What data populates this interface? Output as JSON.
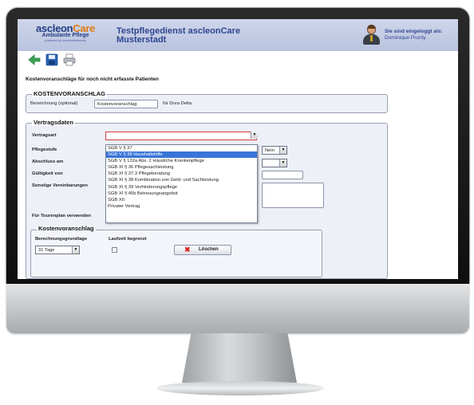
{
  "app": {
    "logo": {
      "brand_a": "ascleon",
      "brand_b": "Care",
      "subtitle": "Ambulante Pflege",
      "tagline": "powered by medicalnetworks"
    },
    "service_name": "Testpflegedienst ascleonCare",
    "service_city": "Musterstadt",
    "login": {
      "label": "Sie sind eingeloggt als:",
      "user": "Dominique Prunty"
    }
  },
  "toolbar": {
    "icons": [
      "back-arrow-icon",
      "save-disk-icon",
      "print-icon"
    ]
  },
  "page": {
    "title": "Kostenvoranschläge für noch nicht erfasste Patienten"
  },
  "kv_section": {
    "legend": "KOSTENVORANSCHLAG",
    "bezeichnung_label": "Bezeichnung (optional)",
    "bezeichnung_value": "Kostenvoranschlag",
    "patient_text": "für Dora Delta"
  },
  "vertrag": {
    "legend": "Vertragsdaten",
    "labels": {
      "vertragsart": "Vertragsart",
      "pflegestufe": "Pflegestufe",
      "abschluss": "Abschluss am",
      "gueltigkeit": "Gültigkeit von",
      "sonstige": "Sonstige Vereinbarungen",
      "tourenplan": "Für Tourenplan verwenden"
    },
    "vertragsart_value": "",
    "nein_value": "Nein",
    "dropdown_options": [
      "SGB V § 37",
      "SGB V § 38 Haushaltshilfe",
      "SGB V § 132a Abs. 2 Häusliche Krankenpflege",
      "SGB XI § 36 Pflegesachleistung",
      "SGB XI § 37.3 Pflegeberatung",
      "SGB XI § 38 Kombination von Geld- und Sachleistung",
      "SGB XI § 39 Verhinderungspflege",
      "SGB XI § 45b Betreuungsangebot",
      "SGB XII",
      "Privater Vertrag"
    ],
    "highlighted_index": 1
  },
  "kostenvoranschlag": {
    "legend": "Kostenvoranschlag",
    "berechnungsgrundlage_label": "Berechnungsgrundlage",
    "laufzeit_label": "Laufzeit begrenzt",
    "tage_value": "31 Tage",
    "delete_label": "Löschen"
  },
  "colors": {
    "header_bg": "#c3cbe4",
    "brand_blue": "#233e84",
    "brand_orange": "#e07b15",
    "highlight": "#3875d7"
  }
}
